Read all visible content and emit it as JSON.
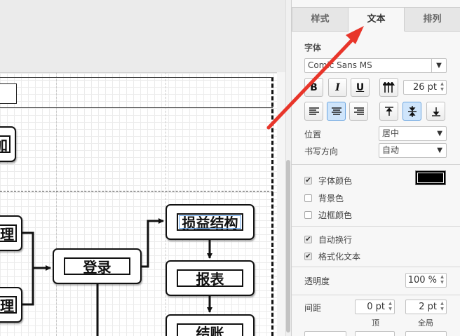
{
  "colors": {
    "accent": "#6aa5e0",
    "annotation": "#e8352a",
    "font_color": "#000000"
  },
  "diagram": {
    "nodes": {
      "top_left_partial": "加",
      "left_mid_partial_1": "理",
      "left_mid_partial_2": "理",
      "login": "登录",
      "profit_structure": "损益结构",
      "report": "报表",
      "checkout": "结账"
    }
  },
  "panel": {
    "tabs": [
      "样式",
      "文本",
      "排列"
    ],
    "active_tab": "文本",
    "font_section": "字体",
    "font_family_value": "Comic Sans MS",
    "style_buttons": {
      "bold": "B",
      "italic": "I",
      "underline": "U"
    },
    "font_size": "26 pt",
    "position_label": "位置",
    "position_value": "居中",
    "writing_direction_label": "书写方向",
    "writing_direction_value": "自动",
    "checks": {
      "font_color": {
        "label": "字体颜色",
        "checked": true
      },
      "background_color": {
        "label": "背景色",
        "checked": false
      },
      "border_color": {
        "label": "边框颜色",
        "checked": false
      },
      "word_wrap": {
        "label": "自动换行",
        "checked": true
      },
      "formatted_text": {
        "label": "格式化文本",
        "checked": true
      }
    },
    "opacity_label": "透明度",
    "opacity_value": "100 %",
    "spacing_label": "间距",
    "spacing_top_value": "0 pt",
    "spacing_global_value": "2 pt",
    "spacing_top_caption": "顶",
    "spacing_global_caption": "全局",
    "check_mark": "✔",
    "spin_up": "▲",
    "spin_down": "▼",
    "select_arrow": "▼",
    "align_icons": [
      "text-align-left-icon",
      "text-align-center-icon",
      "text-align-right-icon"
    ],
    "valign_icons": [
      "vertical-align-top-icon",
      "vertical-align-middle-icon",
      "vertical-align-bottom-icon"
    ]
  }
}
